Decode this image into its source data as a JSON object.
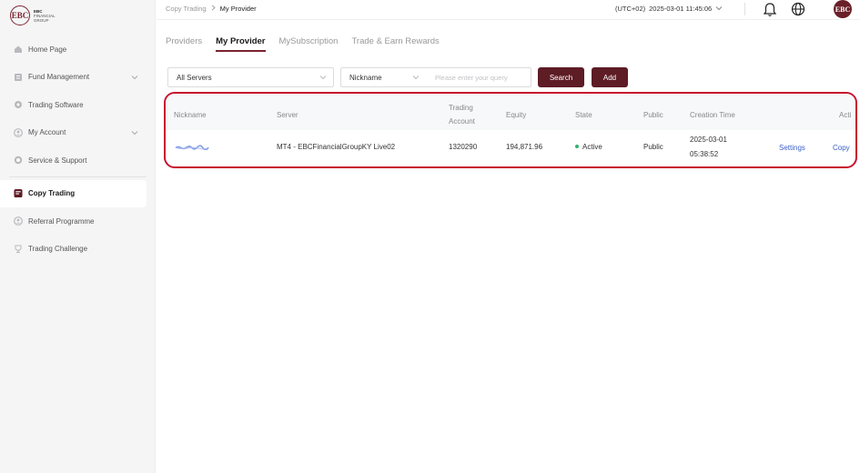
{
  "brand": {
    "logo_mark": "EBC",
    "logo_lines": [
      "EBC",
      "FINANCIAL",
      "GROUP"
    ],
    "accent": "#5e1c25",
    "highlight": "#c8102e"
  },
  "sidebar": {
    "items": [
      {
        "label": "Home Page",
        "icon": "home-icon",
        "chevron": false
      },
      {
        "label": "Fund Management",
        "icon": "fund-icon",
        "chevron": true
      },
      {
        "label": "Trading Software",
        "icon": "software-icon",
        "chevron": false
      },
      {
        "label": "My Account",
        "icon": "user-icon",
        "chevron": true
      },
      {
        "label": "Service & Support",
        "icon": "support-icon",
        "chevron": false
      },
      {
        "label": "Copy Trading",
        "icon": "copy-trading-icon",
        "chevron": false,
        "active": true
      },
      {
        "label": "Referral Programme",
        "icon": "referral-icon",
        "chevron": false
      },
      {
        "label": "Trading Challenge",
        "icon": "trophy-icon",
        "chevron": false
      }
    ]
  },
  "topbar": {
    "breadcrumb": [
      "Copy Trading",
      "My Provider"
    ],
    "timezone": "(UTC+02)",
    "datetime": "2025-03-01 11:45:06",
    "avatar_mark": "EBC"
  },
  "tabs": [
    {
      "label": "Providers",
      "active": false
    },
    {
      "label": "My Provider",
      "active": true
    },
    {
      "label": "MySubscription",
      "active": false
    },
    {
      "label": "Trade & Earn Rewards",
      "active": false
    }
  ],
  "filters": {
    "server_select": "All Servers",
    "field_select": "Nickname",
    "query_placeholder": "Please enter your query",
    "search_label": "Search",
    "add_label": "Add"
  },
  "table": {
    "headers": {
      "nickname": "Nickname",
      "server": "Server",
      "account_l1": "Trading",
      "account_l2": "Account",
      "equity": "Equity",
      "state": "State",
      "public": "Public",
      "created": "Creation Time",
      "actions": "Acti"
    },
    "rows": [
      {
        "server": "MT4 - EBCFinancialGroupKY Live02",
        "account": "1320290",
        "equity": "194,871.96",
        "state": "Active",
        "state_color": "#33b36b",
        "public": "Public",
        "created_date": "2025-03-01",
        "created_time": "05:38:52",
        "action_settings": "Settings",
        "action_copy": "Copy"
      }
    ]
  }
}
